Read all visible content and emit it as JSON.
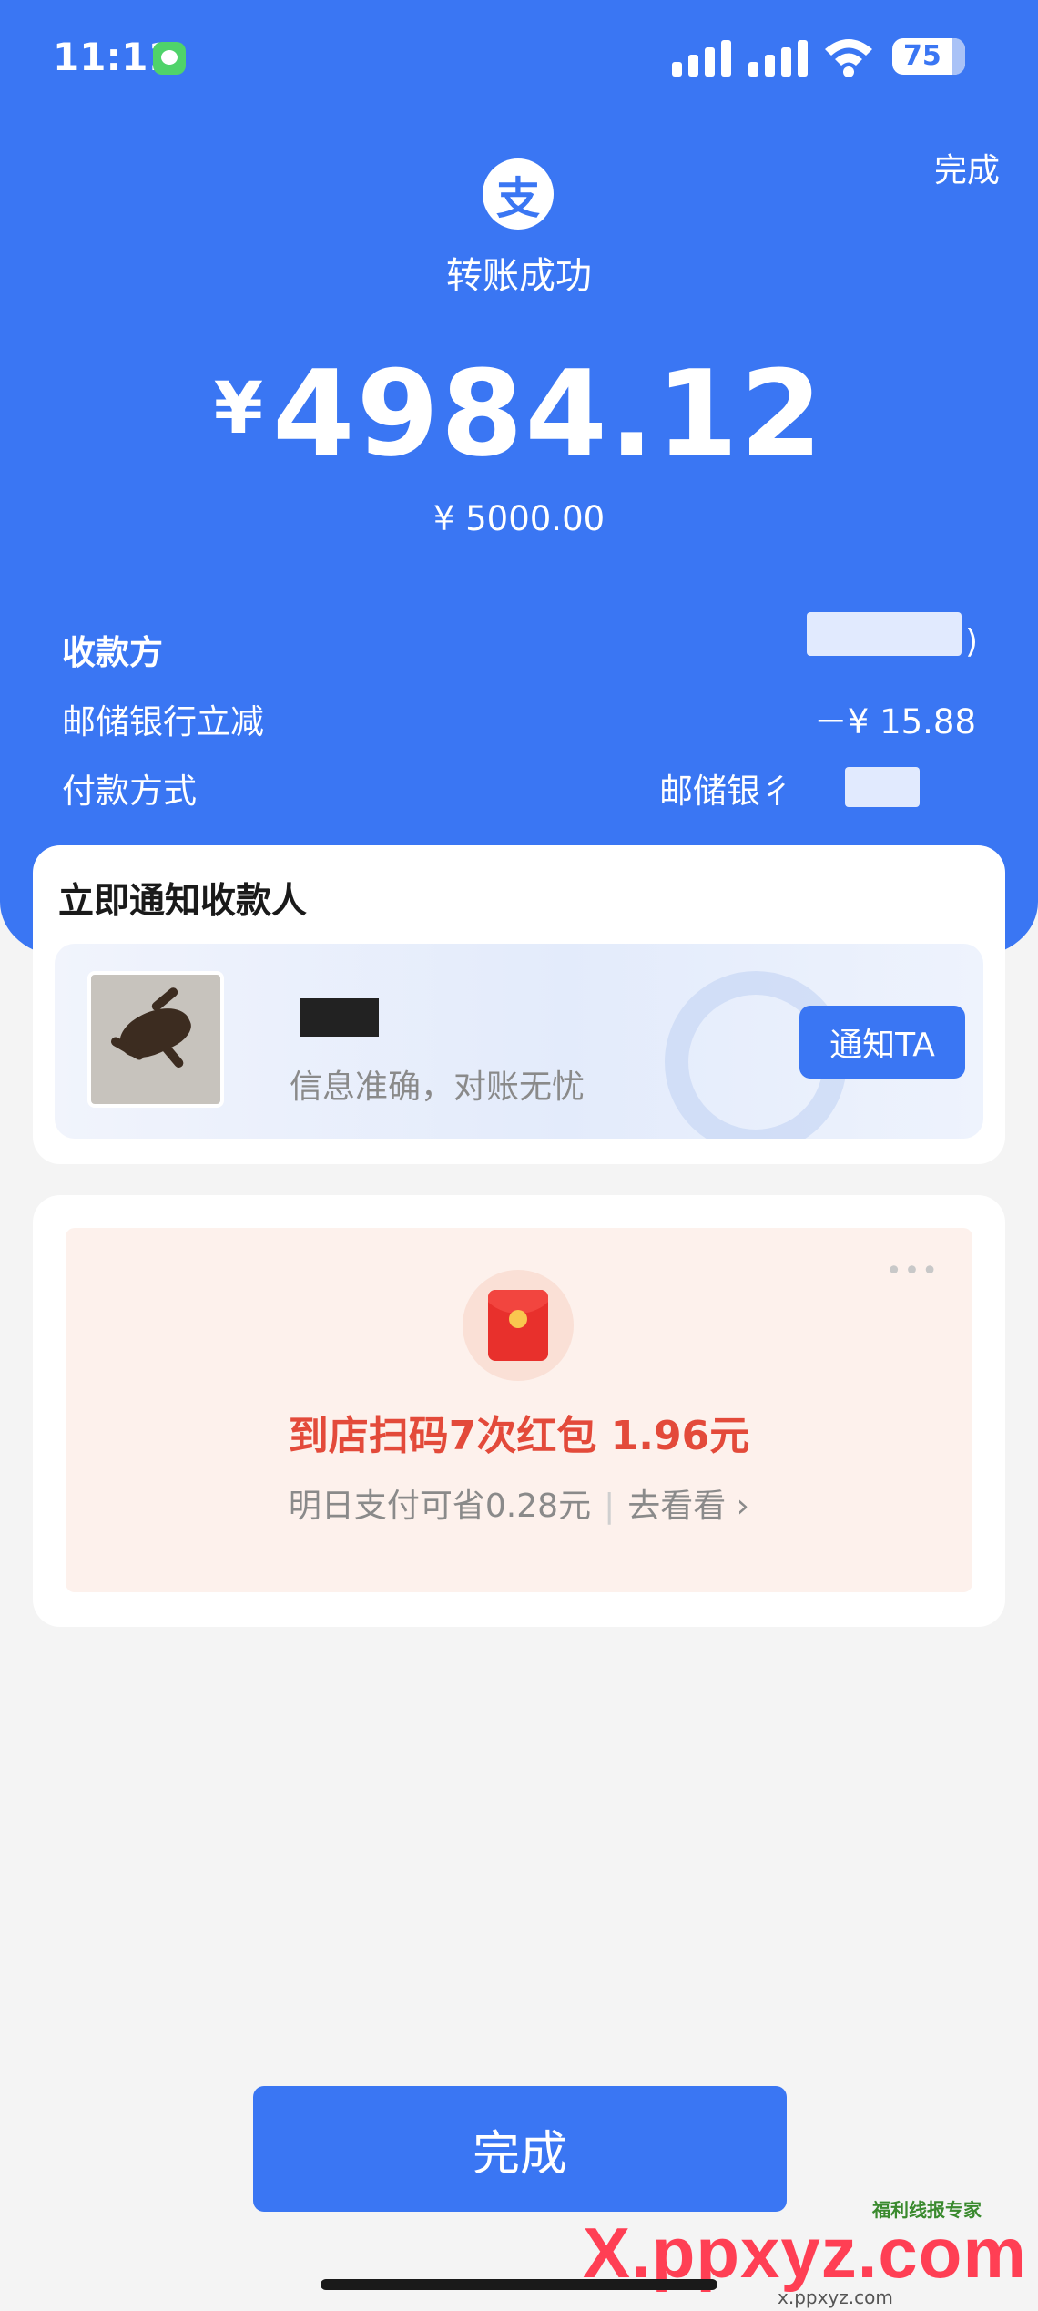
{
  "status_bar": {
    "time": "11:11",
    "battery": "75"
  },
  "header": {
    "done_label": "完成",
    "logo_glyph": "支",
    "status_text": "转账成功",
    "currency_symbol": "¥",
    "amount": "4984.12",
    "original_amount": "¥ 5000.00"
  },
  "details": {
    "payee_label": "收款方",
    "payee_value": "",
    "discount_label": "邮储银行立减",
    "discount_value": "－¥ 15.88",
    "payment_label": "付款方式",
    "payment_value": "邮储银彳"
  },
  "notify": {
    "title": "立即通知收款人",
    "subtitle": "信息准确，对账无忧",
    "button_label": "通知TA"
  },
  "promo": {
    "title": "到店扫码7次红包 1.96元",
    "subtitle": "明日支付可省0.28元",
    "link_label": "去看看",
    "more_icon": "•••"
  },
  "footer": {
    "done_label": "完成"
  },
  "watermark": {
    "brand": "福利线报专家",
    "site": "X.ppxyz.com",
    "site_small": "x.ppxyz.com"
  },
  "colors": {
    "primary": "#3a76f3",
    "promo_red": "#e34a3a",
    "promo_bg": "#fdf1ec"
  }
}
